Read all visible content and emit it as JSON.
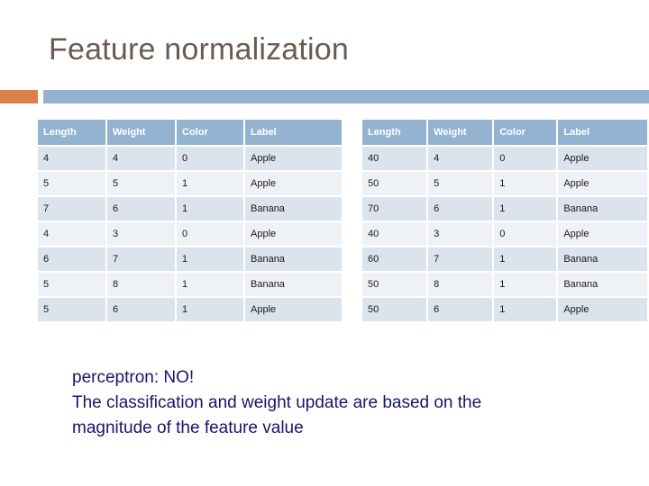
{
  "slide": {
    "title": "Feature normalization",
    "accent_color": "#dd8047",
    "bar_color": "#94b3d1",
    "title_color": "#6b5a52",
    "body_color": "#16166b"
  },
  "tables": {
    "raw": {
      "name": "raw-feature-table",
      "columns": [
        "Length",
        "Weight",
        "Color",
        "Label"
      ],
      "rows": [
        [
          "4",
          "4",
          "0",
          "Apple"
        ],
        [
          "5",
          "5",
          "1",
          "Apple"
        ],
        [
          "7",
          "6",
          "1",
          "Banana"
        ],
        [
          "4",
          "3",
          "0",
          "Apple"
        ],
        [
          "6",
          "7",
          "1",
          "Banana"
        ],
        [
          "5",
          "8",
          "1",
          "Banana"
        ],
        [
          "5",
          "6",
          "1",
          "Apple"
        ]
      ]
    },
    "scaled": {
      "name": "scaled-feature-table",
      "columns": [
        "Length",
        "Weight",
        "Color",
        "Label"
      ],
      "rows": [
        [
          "40",
          "4",
          "0",
          "Apple"
        ],
        [
          "50",
          "5",
          "1",
          "Apple"
        ],
        [
          "70",
          "6",
          "1",
          "Banana"
        ],
        [
          "40",
          "3",
          "0",
          "Apple"
        ],
        [
          "60",
          "7",
          "1",
          "Banana"
        ],
        [
          "50",
          "8",
          "1",
          "Banana"
        ],
        [
          "50",
          "6",
          "1",
          "Apple"
        ]
      ]
    }
  },
  "body": {
    "lines": [
      "perceptron: NO!",
      "The classification and weight update are based on the",
      "magnitude of the feature value"
    ]
  }
}
